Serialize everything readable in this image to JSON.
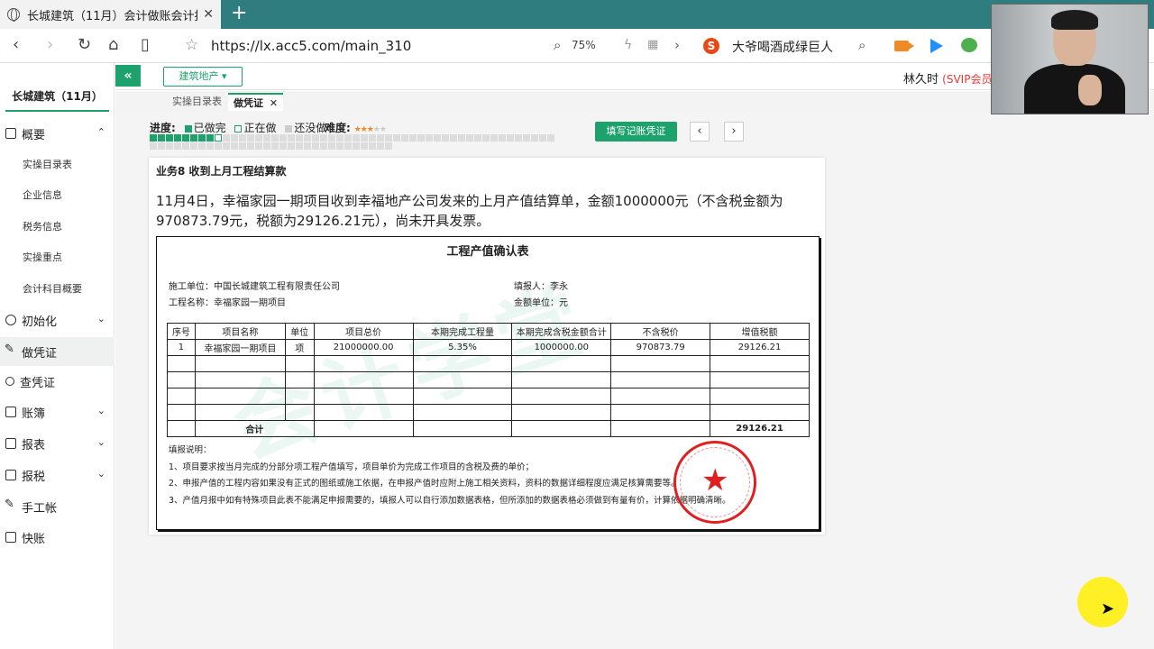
{
  "browser": {
    "tab_title": "长城建筑（11月）会计做账会计报表",
    "tab_close": "✕",
    "new_tab": "+",
    "url": "https://lx.acc5.com/main_310",
    "zoom": "75%",
    "search_badge": "S",
    "search_suggestion": "大爷喝酒成绿巨人",
    "icons": [
      "back-icon",
      "forward-icon",
      "reload-icon",
      "home-icon",
      "reader-icon",
      "star-icon",
      "zoom-icon",
      "search-icon"
    ]
  },
  "app": {
    "collapse": "«",
    "industry": "建筑地产 ▾",
    "user_name": "林久时",
    "user_vip": "(SVIP会员)"
  },
  "sidebar": {
    "company": "长城建筑（11月）",
    "groups": [
      {
        "label": "概要",
        "chevron": "⌃"
      },
      {
        "label": "初始化",
        "chevron": "⌄"
      },
      {
        "label": "做凭证"
      },
      {
        "label": "查凭证"
      },
      {
        "label": "账簿",
        "chevron": "⌄"
      },
      {
        "label": "报表",
        "chevron": "⌄"
      },
      {
        "label": "报税",
        "chevron": "⌄"
      },
      {
        "label": "手工帐"
      },
      {
        "label": "快账"
      }
    ],
    "subitems": [
      "实操目录表",
      "企业信息",
      "税务信息",
      "实操重点",
      "会计科目概要"
    ]
  },
  "subtabs": [
    {
      "label": "实操目录表"
    },
    {
      "label": "做凭证",
      "close": "✕"
    }
  ],
  "progress": {
    "label": "进度:",
    "done": "已做完",
    "doing": "正在做",
    "todo": "还没做",
    "difficulty_label": "难度:",
    "difficulty_stars_on": "★★★",
    "difficulty_stars_off": "★★",
    "done_count": 8,
    "doing_count": 1,
    "total": 80
  },
  "actions": {
    "fill_voucher": "填写记账凭证",
    "prev": "‹",
    "next": "›"
  },
  "task": {
    "title": "业务8 收到上月工程结算款",
    "description": "11月4日，幸福家园一期项目收到幸福地产公司发来的上月产值结算单，金额1000000元（不含税金额为970873.79元，税额为29126.21元），尚未开具发票。"
  },
  "document": {
    "title": "工程产值确认表",
    "construction_unit": "施工单位：中国长城建筑工程有限责任公司",
    "reporter": "填报人：李永",
    "project_name": "工程名称：幸福家园一期项目",
    "amount_unit": "金额单位：元",
    "watermark": "会计学堂",
    "columns": [
      "序号",
      "项目名称",
      "单位",
      "项目总价",
      "本期完成工程量",
      "本期完成含税金额合计",
      "不含税价",
      "增值税额"
    ],
    "rows": [
      [
        "1",
        "幸福家园一期项目",
        "项",
        "21000000.00",
        "5.35%",
        "1000000.00",
        "970873.79",
        "29126.21"
      ],
      [
        "",
        "",
        "",
        "",
        "",
        "",
        "",
        ""
      ],
      [
        "",
        "",
        "",
        "",
        "",
        "",
        "",
        ""
      ],
      [
        "",
        "",
        "",
        "",
        "",
        "",
        "",
        ""
      ],
      [
        "",
        "",
        "",
        "",
        "",
        "",
        "",
        ""
      ],
      [
        "",
        "",
        "",
        "",
        "",
        "",
        "",
        ""
      ]
    ],
    "total_label": "合计",
    "total_tax": "29126.21",
    "notes_title": "填报说明：",
    "notes": [
      "1、项目要求按当月完成的分部分项工程产值填写，项目单价为完成工作项目的含税及费的单价；",
      "2、申报产值的工程内容如果没有正式的图纸或施工依据，在申报产值时应附上施工相关资料，资料的数据详细程度应满足核算需要等。",
      "3、产值月报中如有特殊项目此表不能满足申报需要的，填报人可以自行添加数据表格，但所添加的数据表格必须做到有量有价，计算依据明确清晰。"
    ],
    "seal_text": "幸福地产有限公司"
  },
  "colors": {
    "accent": "#1ea26d",
    "tabbar": "#2f7d7e",
    "vip": "#e53935",
    "seal": "#e02020"
  }
}
